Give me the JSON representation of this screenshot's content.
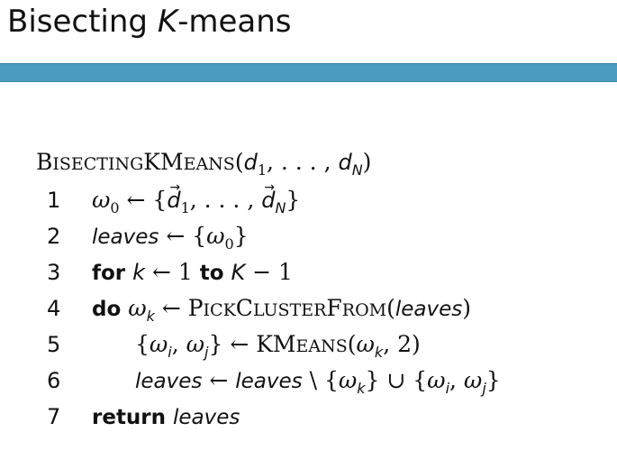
{
  "slide": {
    "title_prefix": "Bisecting ",
    "title_italic": "K",
    "title_suffix": "-means",
    "accent_color": "#4a9bbd"
  },
  "algorithm": {
    "name_parts": [
      "B",
      "ISECTING",
      "KM",
      "EANS"
    ],
    "parameters": "(d1, . . . , dN)",
    "lines": [
      {
        "number": "1",
        "text": "ω0 ← {d⃗1, . . . , d⃗N}"
      },
      {
        "number": "2",
        "text": "leaves ← {ω0}"
      },
      {
        "number": "3",
        "text": "for k ← 1 to K − 1"
      },
      {
        "number": "4",
        "text": "do ωk ← PickClusterFrom(leaves)"
      },
      {
        "number": "5",
        "text": "{ωi, ωj} ← KMeans(ωk, 2)"
      },
      {
        "number": "6",
        "text": "leaves ← leaves \\ {ωk} ∪ {ωi, ωj}"
      },
      {
        "number": "7",
        "text": "return leaves"
      }
    ],
    "tokens": {
      "leaves": "leaves",
      "for": "for",
      "to": "to",
      "do": "do",
      "return": "return",
      "pick_parts": [
        "P",
        "ICK",
        "C",
        "LUSTER",
        "F",
        "ROM"
      ],
      "kmeans_parts": [
        "KM",
        "EANS"
      ]
    }
  }
}
